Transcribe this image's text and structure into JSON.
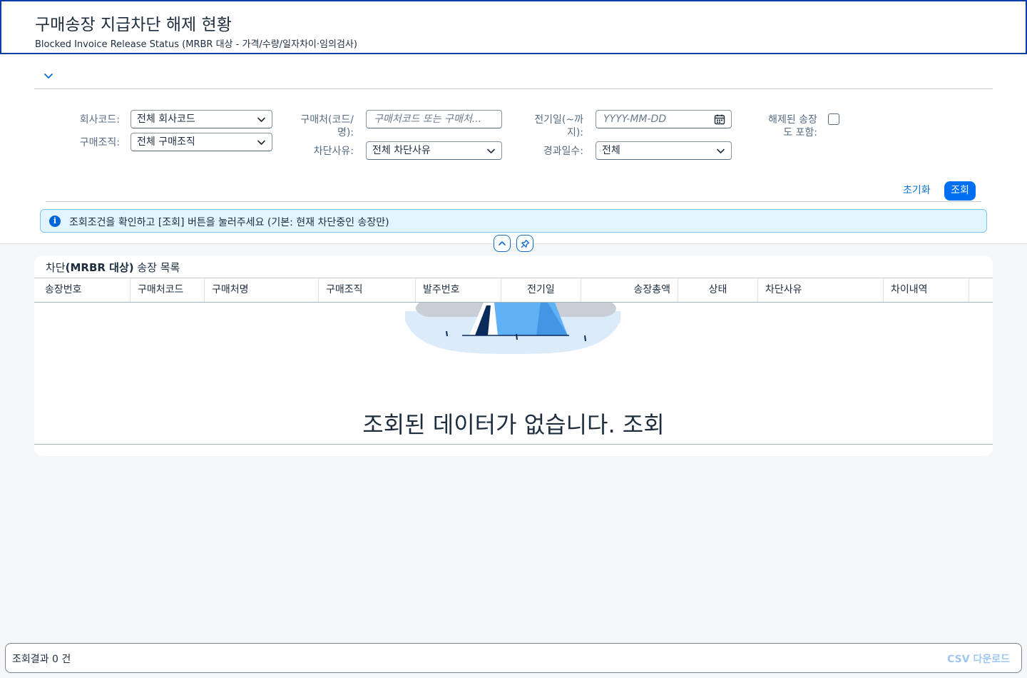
{
  "header": {
    "title": "구매송장 지급차단 해제 현황",
    "subtitle": "Blocked Invoice Release Status (MRBR 대상 - 가격/수량/일자차이·임의검사)"
  },
  "filters": {
    "company_code": {
      "label": "회사코드:",
      "value": "전체 회사코드"
    },
    "purch_org": {
      "label": "구매조직:",
      "value": "전체 구매조직"
    },
    "vendor": {
      "label_line1": "구매처(코드/",
      "label_line2": "명):",
      "placeholder": "구매처코드 또는 구매처..."
    },
    "block_reason": {
      "label": "차단사유:",
      "value": "전체 차단사유"
    },
    "posting_date": {
      "label_line1": "전기일(~까",
      "label_line2": "지):",
      "placeholder": "YYYY-MM-DD"
    },
    "elapsed_days": {
      "label": "경과일수:",
      "value": "전체"
    },
    "include_released": {
      "label_line1": "해제된 송장",
      "label_line2": "도 포함:",
      "checked": false
    }
  },
  "actions": {
    "reset_label": "초기화",
    "search_label": "조회"
  },
  "info_message": "조회조건을 확인하고 [조회] 버튼을 눌러주세요 (기본: 현재 차단중인 송장만)",
  "table": {
    "title_prefix": "차단",
    "title_bold": "(MRBR 대상)",
    "title_suffix": " 송장 목록",
    "columns": [
      "송장번호",
      "구매처코드",
      "구매처명",
      "구매조직",
      "발주번호",
      "전기일",
      "송장총액",
      "상태",
      "차단사유",
      "차이내역"
    ],
    "empty_message": "조회된 데이터가 없습니다. 조회"
  },
  "footer": {
    "result_count": "조회결과 0 건",
    "csv_label": "CSV 다운로드"
  },
  "colors": {
    "accent": "#0070f2",
    "title_border": "#0a3fa8",
    "info_bg": "#e1f4ff"
  },
  "icons": [
    "chevron-down-icon",
    "calendar-icon",
    "info-icon",
    "chevron-up-icon",
    "pin-icon"
  ]
}
